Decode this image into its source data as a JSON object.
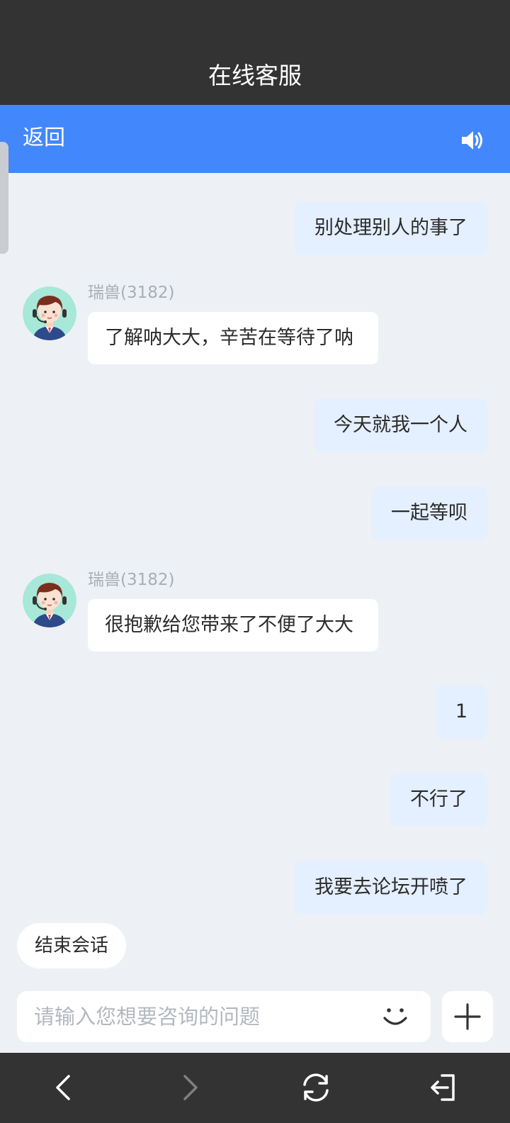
{
  "header": {
    "title": "在线客服"
  },
  "nav": {
    "back_label": "返回",
    "sound_icon": "speaker-icon"
  },
  "messages": [
    {
      "side": "right",
      "text": "别处理别人的事了"
    },
    {
      "side": "left",
      "agent": "瑞兽(3182)",
      "text": "了解呐大大，辛苦在等待了呐"
    },
    {
      "side": "right",
      "text": "今天就我一个人"
    },
    {
      "side": "right",
      "text": "一起等呗"
    },
    {
      "side": "left",
      "agent": "瑞兽(3182)",
      "text": "很抱歉给您带来了不便了大大"
    },
    {
      "side": "right",
      "text": "1"
    },
    {
      "side": "right",
      "text": "不行了"
    },
    {
      "side": "right",
      "text": "我要去论坛开喷了"
    }
  ],
  "actions": {
    "end_session": "结束会话"
  },
  "composer": {
    "placeholder": "请输入您想要咨询的问题",
    "emoji_icon": "smile-icon",
    "plus_icon": "plus-icon"
  },
  "bottom_nav": {
    "icons": [
      "back-arrow-icon",
      "forward-arrow-icon",
      "refresh-icon",
      "exit-icon"
    ]
  },
  "colors": {
    "header_bg": "#333333",
    "accent": "#4287fc",
    "chat_bg": "#edf1f5",
    "user_bubble": "#e4efff",
    "agent_bubble": "#ffffff",
    "agent_name": "#a8aeb6"
  }
}
